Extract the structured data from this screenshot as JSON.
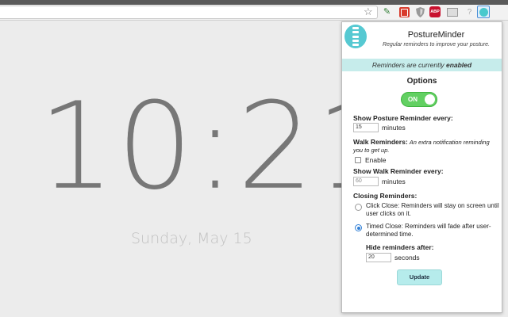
{
  "browser": {
    "icons": [
      "star-icon",
      "pen-extension-icon",
      "book-extension-icon",
      "shield-extension-icon",
      "adblock-extension-icon",
      "screen-extension-icon",
      "help-extension-icon",
      "postureminder-extension-icon",
      "menu-icon"
    ],
    "abp_label": "ABP",
    "help_label": "?"
  },
  "clock": {
    "time": "10:21",
    "date": "Sunday, May 15"
  },
  "popup": {
    "title": "PostureMinder",
    "subtitle": "Regular reminders to improve your posture.",
    "status_prefix": "Reminders are currently ",
    "status_value": "enabled",
    "options_title": "Options",
    "toggle_label": "ON",
    "toggle_on": true,
    "posture_label": "Show Posture Reminder every:",
    "posture_value": "15",
    "posture_unit": "minutes",
    "walk_title": "Walk Reminders:",
    "walk_desc": "An extra notification reminding you to get up.",
    "walk_enable_label": "Enable",
    "walk_enabled": false,
    "walk_every_label": "Show Walk Reminder every:",
    "walk_value": "60",
    "walk_unit": "minutes",
    "closing_title": "Closing Reminders:",
    "click_close": "Click Close: Reminders will stay on screen until user clicks on it.",
    "timed_close": "Timed Close: Reminders will fade after user-determined time.",
    "selected_close": "timed",
    "hide_label": "Hide reminders after:",
    "hide_value": "20",
    "hide_unit": "seconds",
    "update_label": "Update",
    "colors": {
      "accent": "#48c9cd",
      "status_bg": "#c6eceb",
      "toggle_green": "#62d062",
      "radio_blue": "#2f7fd6"
    }
  }
}
